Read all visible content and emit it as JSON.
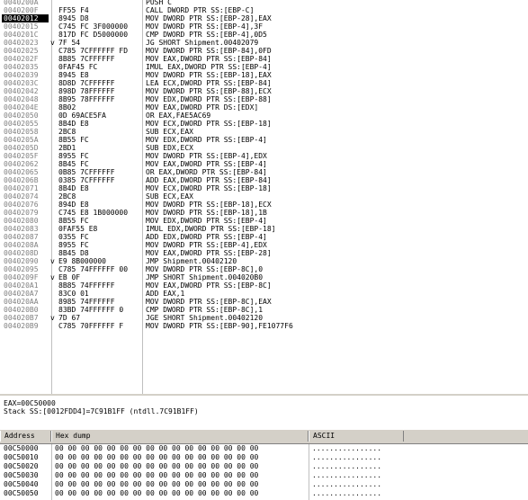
{
  "disasm": {
    "rows": [
      {
        "addr": "0040200A",
        "arrow": "",
        "hex": "",
        "instr": "PUSH C"
      },
      {
        "addr": "0040200F",
        "arrow": "",
        "hex": "FF55 F4",
        "instr": "CALL DWORD PTR SS:[EBP-C]"
      },
      {
        "addr": "00402012",
        "arrow": "",
        "hex": "8945 D8",
        "instr": "MOV DWORD PTR SS:[EBP-28],EAX",
        "current": true
      },
      {
        "addr": "00402015",
        "arrow": "",
        "hex": "C745 FC 3F000000",
        "instr": "MOV DWORD PTR SS:[EBP-4],3F"
      },
      {
        "addr": "0040201C",
        "arrow": "",
        "hex": "817D FC D5000000",
        "instr": "CMP DWORD PTR SS:[EBP-4],0D5"
      },
      {
        "addr": "00402023",
        "arrow": "v",
        "hex": "7F 54",
        "instr": "JG SHORT Shipment.00402079"
      },
      {
        "addr": "00402025",
        "arrow": "",
        "hex": "C785 7CFFFFFF FD",
        "instr": "MOV DWORD PTR SS:[EBP-84],0FD"
      },
      {
        "addr": "0040202F",
        "arrow": "",
        "hex": "8B85 7CFFFFFF",
        "instr": "MOV EAX,DWORD PTR SS:[EBP-84]"
      },
      {
        "addr": "00402035",
        "arrow": "",
        "hex": "0FAF45 FC",
        "instr": "IMUL EAX,DWORD PTR SS:[EBP-4]"
      },
      {
        "addr": "00402039",
        "arrow": "",
        "hex": "8945 E8",
        "instr": "MOV DWORD PTR SS:[EBP-18],EAX"
      },
      {
        "addr": "0040203C",
        "arrow": "",
        "hex": "8D8D 7CFFFFFF",
        "instr": "LEA ECX,DWORD PTR SS:[EBP-84]"
      },
      {
        "addr": "00402042",
        "arrow": "",
        "hex": "898D 78FFFFFF",
        "instr": "MOV DWORD PTR SS:[EBP-88],ECX"
      },
      {
        "addr": "00402048",
        "arrow": "",
        "hex": "8B95 78FFFFFF",
        "instr": "MOV EDX,DWORD PTR SS:[EBP-88]"
      },
      {
        "addr": "0040204E",
        "arrow": "",
        "hex": "8B02",
        "instr": "MOV EAX,DWORD PTR DS:[EDX]"
      },
      {
        "addr": "00402050",
        "arrow": "",
        "hex": "0D 69ACE5FA",
        "instr": "OR EAX,FAE5AC69"
      },
      {
        "addr": "00402055",
        "arrow": "",
        "hex": "8B4D E8",
        "instr": "MOV ECX,DWORD PTR SS:[EBP-18]"
      },
      {
        "addr": "00402058",
        "arrow": "",
        "hex": "2BC8",
        "instr": "SUB ECX,EAX"
      },
      {
        "addr": "0040205A",
        "arrow": "",
        "hex": "8B55 FC",
        "instr": "MOV EDX,DWORD PTR SS:[EBP-4]"
      },
      {
        "addr": "0040205D",
        "arrow": "",
        "hex": "2BD1",
        "instr": "SUB EDX,ECX"
      },
      {
        "addr": "0040205F",
        "arrow": "",
        "hex": "8955 FC",
        "instr": "MOV DWORD PTR SS:[EBP-4],EDX"
      },
      {
        "addr": "00402062",
        "arrow": "",
        "hex": "8B45 FC",
        "instr": "MOV EAX,DWORD PTR SS:[EBP-4]"
      },
      {
        "addr": "00402065",
        "arrow": "",
        "hex": "0B85 7CFFFFFF",
        "instr": "OR EAX,DWORD PTR SS:[EBP-84]"
      },
      {
        "addr": "0040206B",
        "arrow": "",
        "hex": "0385 7CFFFFFF",
        "instr": "ADD EAX,DWORD PTR SS:[EBP-84]"
      },
      {
        "addr": "00402071",
        "arrow": "",
        "hex": "8B4D E8",
        "instr": "MOV ECX,DWORD PTR SS:[EBP-18]"
      },
      {
        "addr": "00402074",
        "arrow": "",
        "hex": "2BC8",
        "instr": "SUB ECX,EAX"
      },
      {
        "addr": "00402076",
        "arrow": "",
        "hex": "894D E8",
        "instr": "MOV DWORD PTR SS:[EBP-18],ECX"
      },
      {
        "addr": "00402079",
        "arrow": "",
        "hex": "C745 E8 1B000000",
        "instr": "MOV DWORD PTR SS:[EBP-18],1B"
      },
      {
        "addr": "00402080",
        "arrow": "",
        "hex": "8B55 FC",
        "instr": "MOV EDX,DWORD PTR SS:[EBP-4]"
      },
      {
        "addr": "00402083",
        "arrow": "",
        "hex": "0FAF55 E8",
        "instr": "IMUL EDX,DWORD PTR SS:[EBP-18]"
      },
      {
        "addr": "00402087",
        "arrow": "",
        "hex": "0355 FC",
        "instr": "ADD EDX,DWORD PTR SS:[EBP-4]"
      },
      {
        "addr": "0040208A",
        "arrow": "",
        "hex": "8955 FC",
        "instr": "MOV DWORD PTR SS:[EBP-4],EDX"
      },
      {
        "addr": "0040208D",
        "arrow": "",
        "hex": "8B45 D8",
        "instr": "MOV EAX,DWORD PTR SS:[EBP-28]"
      },
      {
        "addr": "00402090",
        "arrow": "v",
        "hex": "E9 8B000000",
        "instr": "JMP Shipment.00402120"
      },
      {
        "addr": "00402095",
        "arrow": "",
        "hex": "C785 74FFFFFF 00",
        "instr": "MOV DWORD PTR SS:[EBP-8C],0"
      },
      {
        "addr": "0040209F",
        "arrow": "v",
        "hex": "EB 0F",
        "instr": "JMP SHORT Shipment.004020B0"
      },
      {
        "addr": "004020A1",
        "arrow": "",
        "hex": "8B85 74FFFFFF",
        "instr": "MOV EAX,DWORD PTR SS:[EBP-8C]"
      },
      {
        "addr": "004020A7",
        "arrow": "",
        "hex": "83C0 01",
        "instr": "ADD EAX,1"
      },
      {
        "addr": "004020AA",
        "arrow": "",
        "hex": "8985 74FFFFFF",
        "instr": "MOV DWORD PTR SS:[EBP-8C],EAX"
      },
      {
        "addr": "004020B0",
        "arrow": "",
        "hex": "83BD 74FFFFFF 0",
        "instr": "CMP DWORD PTR SS:[EBP-8C],1"
      },
      {
        "addr": "004020B7",
        "arrow": "v",
        "hex": "7D 67",
        "instr": "JGE SHORT Shipment.00402120"
      },
      {
        "addr": "004020B9",
        "arrow": "",
        "hex": "C785 70FFFFFF F",
        "instr": "MOV DWORD PTR SS:[EBP-90],FE1077F6"
      }
    ]
  },
  "info": {
    "line1": "EAX=00C50000",
    "line2": "Stack SS:[0012FDD4]=7C91B1FF (ntdll.7C91B1FF)"
  },
  "dump": {
    "headers": {
      "address": "Address",
      "hex": "Hex dump",
      "ascii": "ASCII"
    },
    "rows": [
      {
        "addr": "00C50000",
        "hex": "00 00 00 00 00 00 00 00 00 00 00 00 00 00 00 00",
        "ascii": "................"
      },
      {
        "addr": "00C50010",
        "hex": "00 00 00 00 00 00 00 00 00 00 00 00 00 00 00 00",
        "ascii": "................"
      },
      {
        "addr": "00C50020",
        "hex": "00 00 00 00 00 00 00 00 00 00 00 00 00 00 00 00",
        "ascii": "................"
      },
      {
        "addr": "00C50030",
        "hex": "00 00 00 00 00 00 00 00 00 00 00 00 00 00 00 00",
        "ascii": "................"
      },
      {
        "addr": "00C50040",
        "hex": "00 00 00 00 00 00 00 00 00 00 00 00 00 00 00 00",
        "ascii": "................"
      },
      {
        "addr": "00C50050",
        "hex": "00 00 00 00 00 00 00 00 00 00 00 00 00 00 00 00",
        "ascii": "................"
      }
    ]
  }
}
